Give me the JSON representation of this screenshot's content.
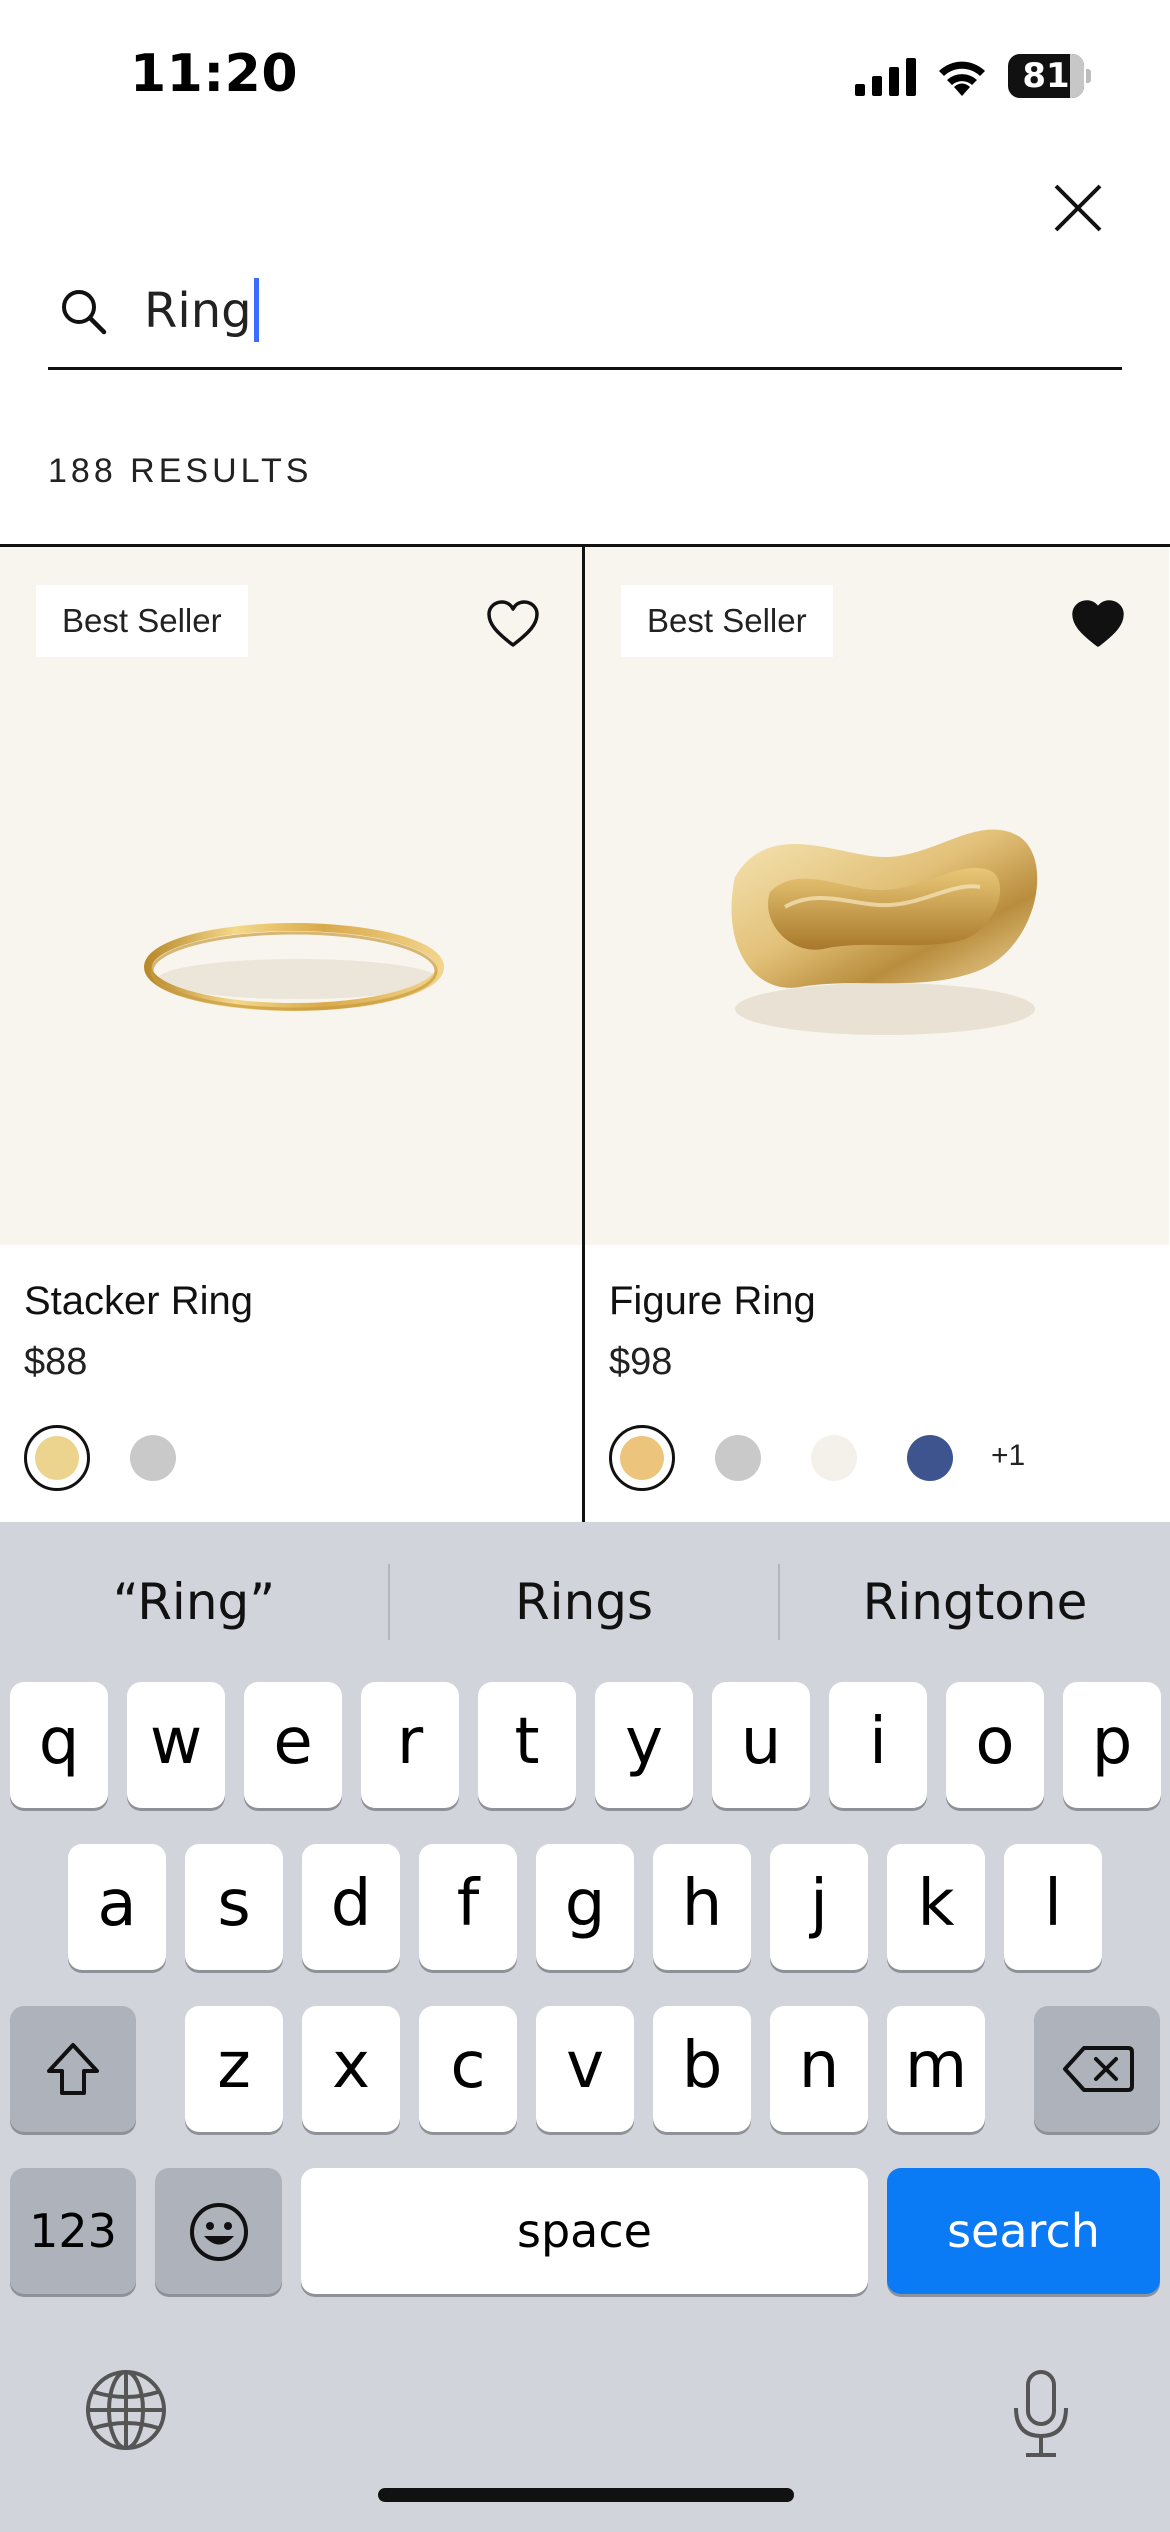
{
  "status_bar": {
    "time": "11:20",
    "battery_percent": "81",
    "battery_level": 0.81
  },
  "search": {
    "value": "Ring",
    "close_icon": "close-icon",
    "search_icon": "search-icon"
  },
  "results": {
    "count_label": "188 RESULTS"
  },
  "products": [
    {
      "badge": "Best Seller",
      "name": "Stacker Ring",
      "price": "$88",
      "favorited": false,
      "image": "thin-gold-band-ring",
      "swatches": [
        {
          "color": "#ecd48e",
          "selected": true
        },
        {
          "color": "#c9c9c9",
          "selected": false
        }
      ]
    },
    {
      "badge": "Best Seller",
      "name": "Figure Ring",
      "price": "$98",
      "favorited": true,
      "image": "wavy-gold-ring",
      "swatches": [
        {
          "color": "#ecc47c",
          "selected": true
        },
        {
          "color": "#c9c9c9",
          "selected": false
        },
        {
          "color": "#f3f1ea",
          "selected": false
        },
        {
          "color": "#3d548f",
          "selected": false
        }
      ],
      "more_swatches": "+1"
    }
  ],
  "keyboard": {
    "suggestions": [
      "“Ring”",
      "Rings",
      "Ringtone"
    ],
    "row1": [
      "q",
      "w",
      "e",
      "r",
      "t",
      "y",
      "u",
      "i",
      "o",
      "p"
    ],
    "row2": [
      "a",
      "s",
      "d",
      "f",
      "g",
      "h",
      "j",
      "k",
      "l"
    ],
    "row3": [
      "z",
      "x",
      "c",
      "v",
      "b",
      "n",
      "m"
    ],
    "numbers_key": "123",
    "space_key": "space",
    "search_key": "search",
    "accent_color": "#0a7bf5"
  }
}
